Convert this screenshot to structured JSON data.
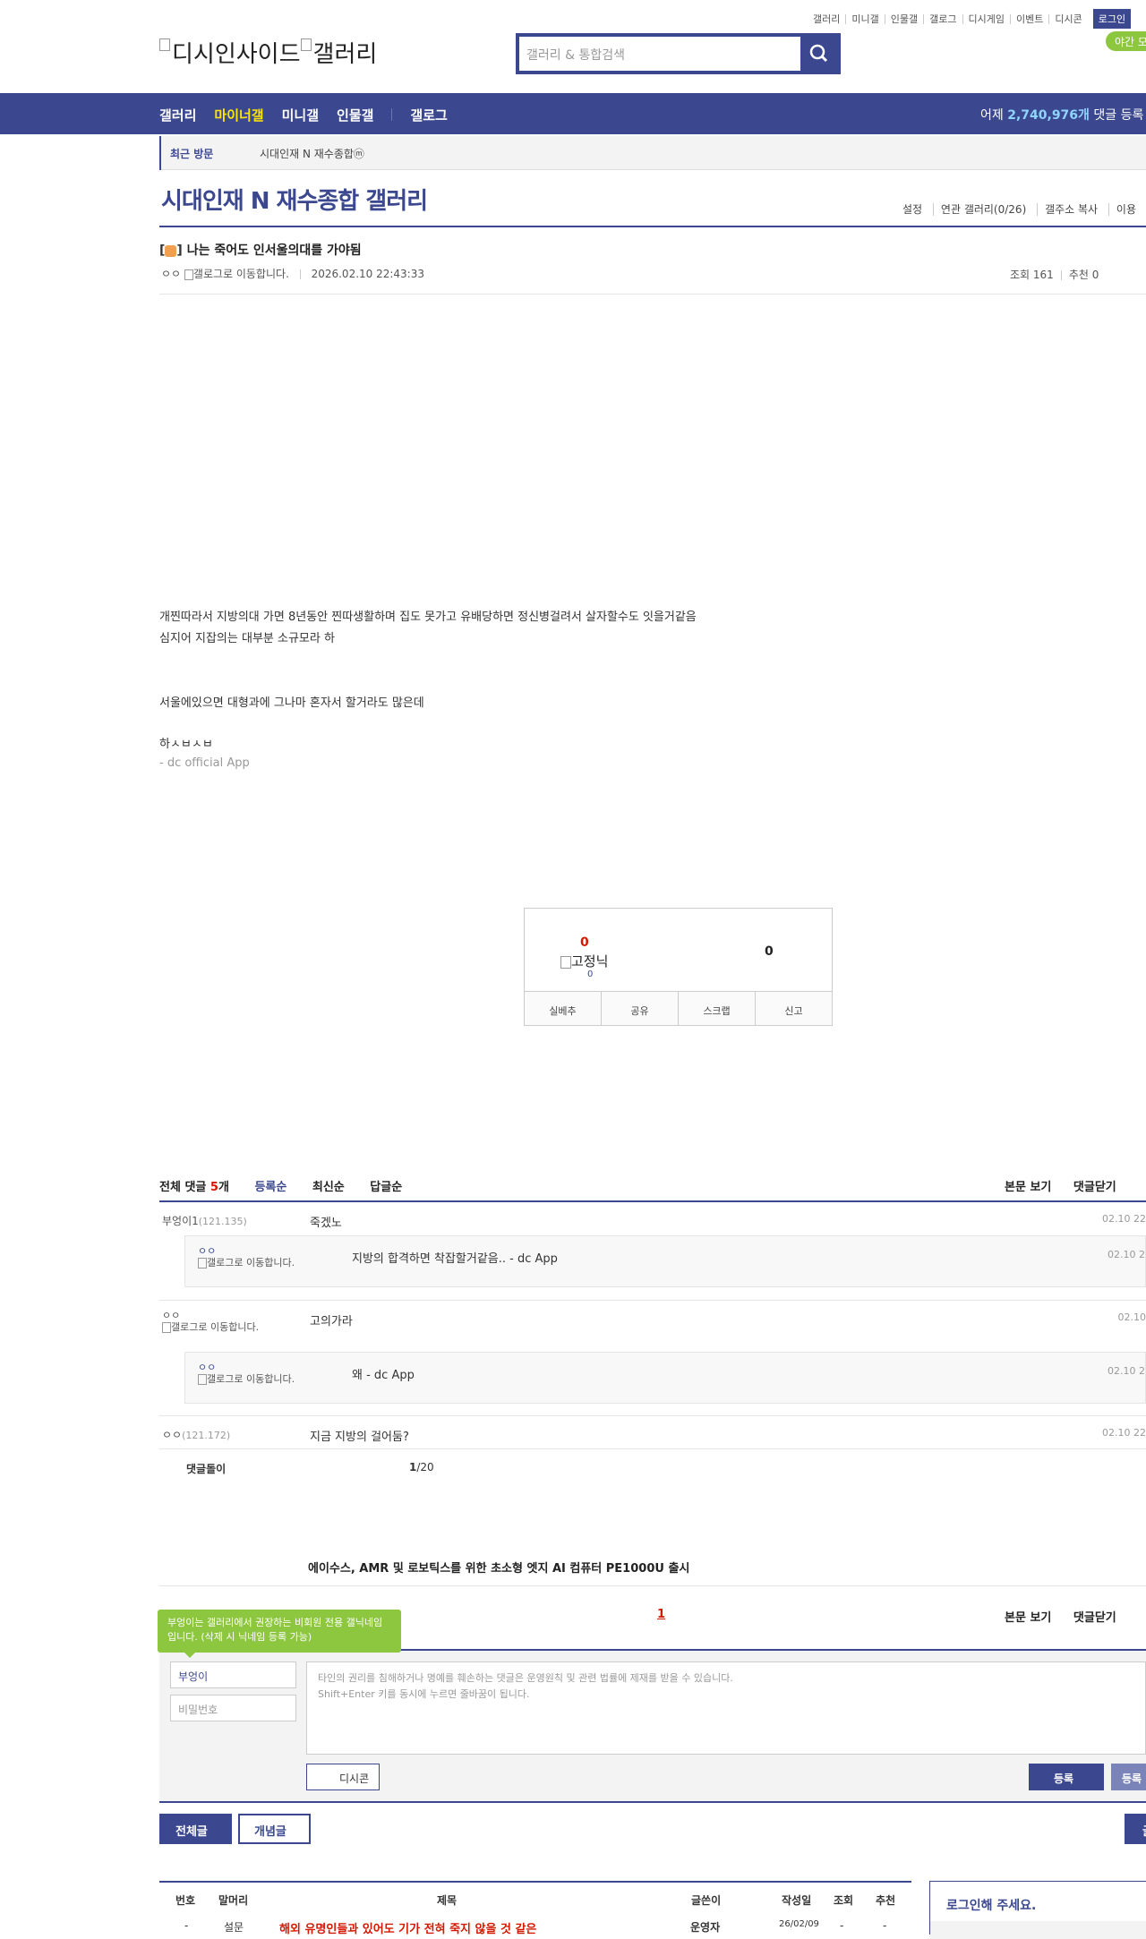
{
  "topmenu": {
    "items": [
      "갤러리",
      "미니갤",
      "인물갤",
      "갤로그",
      "디시게임",
      "이벤트",
      "디시콘"
    ],
    "login": "로그인"
  },
  "header": {
    "logo_alt_1": "디시인사이드",
    "logo_alt_2": "갤러리",
    "search_placeholder": "갤러리 & 통합검색",
    "night_mode": "야간 모"
  },
  "gnb": {
    "items": [
      "갤러리",
      "마이너갤",
      "미니갤",
      "인물갤",
      "갤로그"
    ],
    "stat_prefix": "어제 ",
    "stat_value": "2,740,976개",
    "stat_suffix": " 댓글 등록"
  },
  "recent": {
    "label": "최근 방문",
    "item": "시대인재 N 재수종합ⓜ"
  },
  "gallery": {
    "title": "시대인재 N 재수종합 갤러리",
    "menu": [
      "설정",
      "연관 갤러리(0/26)",
      "갤주소 복사",
      "이용"
    ]
  },
  "post": {
    "head": "[",
    "head_icon": "owl-icon",
    "head_close": "]",
    "title": "나는 죽어도 인서울의대를 가야됨",
    "writer": "ㅇㅇ",
    "writer_img_alt": "갤로그로 이동합니다.",
    "date": "2026.02.10 22:43:33",
    "views": "조회 161",
    "recommends": "추천 0",
    "body": [
      "개찐따라서 지방의대 가면 8년동안 찐따생활하며 집도 못가고 유배당하면 정신병걸려서 살자할수도 잇을거같음",
      "심지어 지잡의는 대부분 소규모라 하",
      "서울에있으면 대형과에 그나마 혼자서 할거라도 많은데",
      "하ㅅㅂㅅㅂ",
      "- dc official App"
    ]
  },
  "recommend": {
    "up": "0",
    "fixed_alt": "고정닉",
    "up_fixed": "0",
    "down": "0",
    "buttons": [
      "실베추",
      "공유",
      "스크랩",
      "신고"
    ]
  },
  "comments": {
    "total_label": "전체 댓글 ",
    "total_num": "5",
    "total_unit": "개",
    "sorts": [
      "등록순",
      "최신순",
      "답글순"
    ],
    "right": [
      "본문 보기",
      "댓글닫기"
    ],
    "list": [
      {
        "nick": "부엉이1",
        "ip": "(121.135)",
        "text": "죽겠노",
        "date": "02.10 22"
      },
      {
        "nick": "ㅇㅇ",
        "img_alt": "갤로그로 이동합니다.",
        "text": "지방의 합격하면 착잡할거같음.. - dc App",
        "date": "02.10 2"
      },
      {
        "nick": "ㅇㅇ",
        "img_alt": "갤로그로 이동합니다.",
        "text": "고의가라",
        "date": "02.10"
      },
      {
        "nick": "ㅇㅇ",
        "img_alt": "갤로그로 이동합니다.",
        "text": "왜 - dc App",
        "date": "02.10 2"
      },
      {
        "nick": "ㅇㅇ",
        "ip": "(121.172)",
        "text": "지금 지방의 걸어둠?",
        "date": "02.10 22"
      }
    ],
    "dolbot": "댓글돌이",
    "page_cur": "1",
    "page_total": "/20",
    "ad": "에이수스, AMR 및 로보틱스를 위한 초소형 엣지 AI 컴퓨터 PE1000U 출시",
    "page_link": "1"
  },
  "write": {
    "tip": "부엉이는 갤러리에서 권장하는 비회원 전용 갤닉네임입니다. (삭제 시 닉네임 등록 가능)",
    "nick_value": "부엉이",
    "pw_placeholder": "비밀번호",
    "textarea_line1": "타인의 권리를 침해하거나 명예를 훼손하는 댓글은 운영원칙 및 관련 법률에 제재를 받을 수 있습니다.",
    "textarea_line2": "Shift+Enter 키를 동시에 누르면 줄바꿈이 됩니다.",
    "dccon": "디시콘",
    "register": "등록",
    "register2": "등록"
  },
  "bottom": {
    "all": "전체글",
    "concept": "개념글",
    "right": "글",
    "headers": [
      "번호",
      "말머리",
      "제목",
      "글쓴이",
      "작성일",
      "조회",
      "추천"
    ],
    "row": {
      "no": "-",
      "head": "설문",
      "title": "해외 유명인들과 있어도 기가 전혀 죽지 않을 것 같은",
      "writer": "운영자",
      "date": "26/02/09",
      "views": "-",
      "rec": "-"
    },
    "login_title": "로그인해 주세요."
  },
  "colors": {
    "primary": "#3b4890",
    "accent": "#ffe600",
    "red": "#d31900",
    "green": "#8dc63f"
  }
}
